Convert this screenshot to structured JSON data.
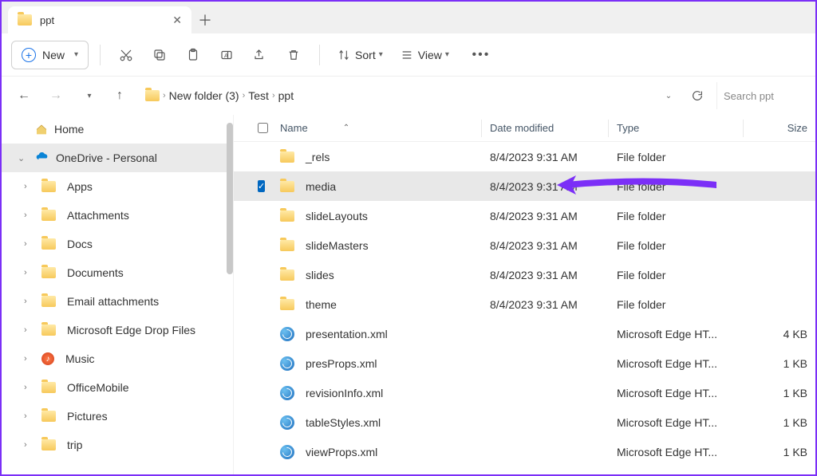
{
  "tab": {
    "title": "ppt"
  },
  "toolbar": {
    "new_label": "New",
    "sort_label": "Sort",
    "view_label": "View"
  },
  "breadcrumb": {
    "segments": [
      "New folder (3)",
      "Test",
      "ppt"
    ]
  },
  "search": {
    "placeholder": "Search ppt"
  },
  "sidebar": {
    "home": "Home",
    "onedrive": "OneDrive - Personal",
    "items": [
      {
        "label": "Apps"
      },
      {
        "label": "Attachments"
      },
      {
        "label": "Docs"
      },
      {
        "label": "Documents"
      },
      {
        "label": "Email attachments"
      },
      {
        "label": "Microsoft Edge Drop Files"
      },
      {
        "label": "Music",
        "icon": "music"
      },
      {
        "label": "OfficeMobile"
      },
      {
        "label": "Pictures"
      },
      {
        "label": "trip"
      }
    ]
  },
  "columns": {
    "name": "Name",
    "date": "Date modified",
    "type": "Type",
    "size": "Size"
  },
  "files": [
    {
      "name": "_rels",
      "date": "8/4/2023 9:31 AM",
      "type": "File folder",
      "size": "",
      "kind": "folder"
    },
    {
      "name": "media",
      "date": "8/4/2023 9:31 AM",
      "type": "File folder",
      "size": "",
      "kind": "folder",
      "selected": true
    },
    {
      "name": "slideLayouts",
      "date": "8/4/2023 9:31 AM",
      "type": "File folder",
      "size": "",
      "kind": "folder"
    },
    {
      "name": "slideMasters",
      "date": "8/4/2023 9:31 AM",
      "type": "File folder",
      "size": "",
      "kind": "folder"
    },
    {
      "name": "slides",
      "date": "8/4/2023 9:31 AM",
      "type": "File folder",
      "size": "",
      "kind": "folder"
    },
    {
      "name": "theme",
      "date": "8/4/2023 9:31 AM",
      "type": "File folder",
      "size": "",
      "kind": "folder"
    },
    {
      "name": "presentation.xml",
      "date": "",
      "type": "Microsoft Edge HT...",
      "size": "4 KB",
      "kind": "file"
    },
    {
      "name": "presProps.xml",
      "date": "",
      "type": "Microsoft Edge HT...",
      "size": "1 KB",
      "kind": "file"
    },
    {
      "name": "revisionInfo.xml",
      "date": "",
      "type": "Microsoft Edge HT...",
      "size": "1 KB",
      "kind": "file"
    },
    {
      "name": "tableStyles.xml",
      "date": "",
      "type": "Microsoft Edge HT...",
      "size": "1 KB",
      "kind": "file"
    },
    {
      "name": "viewProps.xml",
      "date": "",
      "type": "Microsoft Edge HT...",
      "size": "1 KB",
      "kind": "file"
    }
  ]
}
